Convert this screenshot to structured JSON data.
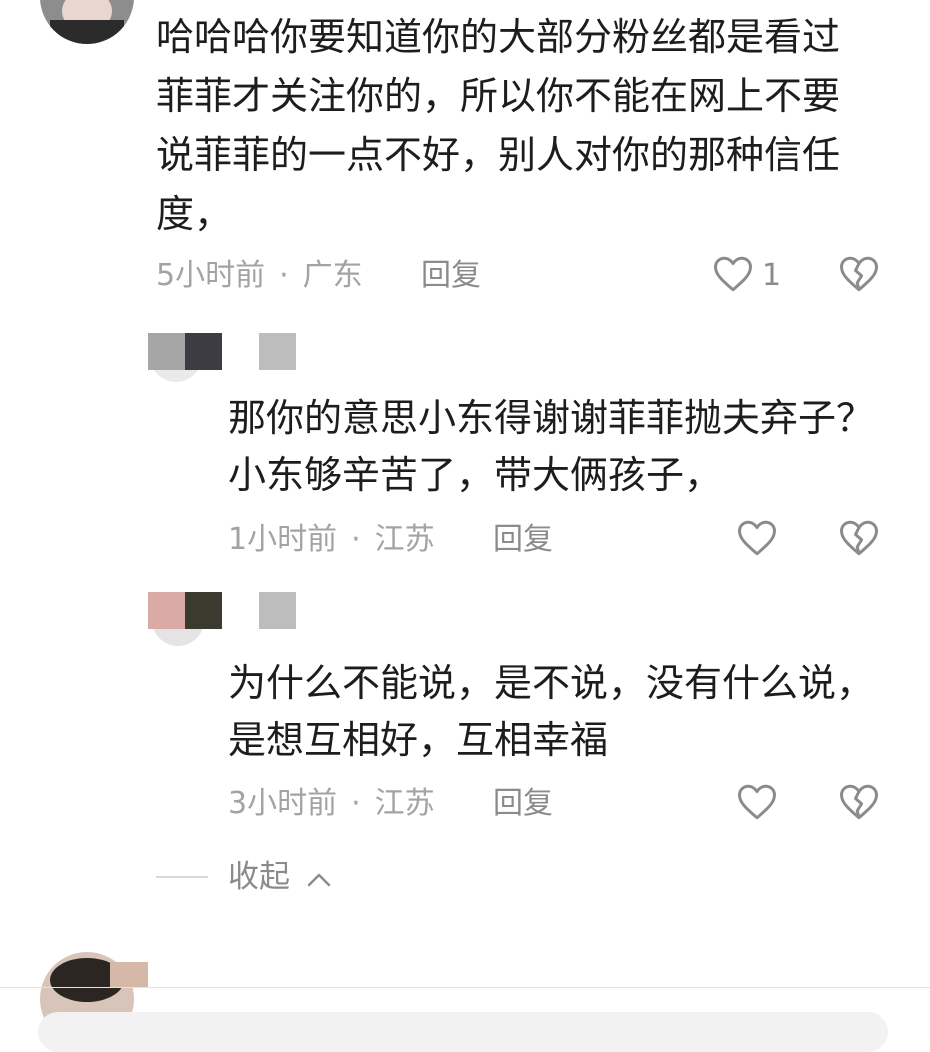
{
  "comment": {
    "text": "哈哈哈你要知道你的大部分粉丝都是看过\n菲菲才关注你的，所以你不能在网上不要\n说菲菲的一点不好，别人对你的那种信任\n度，",
    "time": "5小时前",
    "separator": "·",
    "location": "广东",
    "reply_label": "回复",
    "like_count": "1",
    "like_icon": "heart-outline-icon",
    "dislike_icon": "broken-heart-icon"
  },
  "replies": [
    {
      "text": "那你的意思小东得谢谢菲菲抛夫弃子？\n小东够辛苦了，带大俩孩子，",
      "time": "1小时前",
      "separator": "·",
      "location": "江苏",
      "reply_label": "回复",
      "mosaic_colors": [
        "#a6a6a6",
        "#3d3c45",
        "#ffffff",
        "#bdbdbd"
      ]
    },
    {
      "text": "为什么不能说，是不说，没有什么说，\n是想互相好，互相幸福",
      "time": "3小时前",
      "separator": "·",
      "location": "江苏",
      "reply_label": "回复",
      "mosaic_colors": [
        "#d9aaa6",
        "#3b3a2e",
        "#ffffff",
        "#bdbdbd"
      ]
    }
  ],
  "collapse_label": "收起",
  "colors": {
    "text": "#1d1d1d",
    "meta": "#a3a3a3",
    "icon": "#8b8b8b"
  }
}
